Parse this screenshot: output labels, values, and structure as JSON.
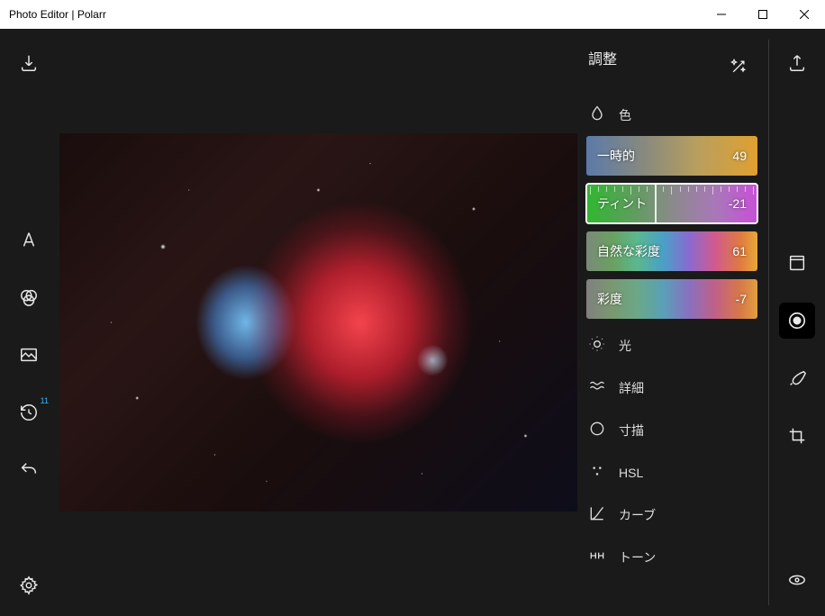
{
  "window": {
    "title": "Photo Editor | Polarr"
  },
  "left_rail": {
    "history_badge": "11"
  },
  "panel": {
    "title": "調整",
    "sections": {
      "color": "色",
      "light": "光",
      "detail": "詳細",
      "vignette": "寸描",
      "hsl": "HSL",
      "curve": "カーブ",
      "tone": "トーン"
    },
    "sliders": {
      "temperature": {
        "label": "一時的",
        "value": "49",
        "pos": 72
      },
      "tint": {
        "label": "ティント",
        "value": "-21",
        "pos": 40,
        "selected": true
      },
      "vibrance": {
        "label": "自然な彩度",
        "value": "61",
        "pos": 79
      },
      "saturation": {
        "label": "彩度",
        "value": "-7",
        "pos": 47
      }
    }
  }
}
